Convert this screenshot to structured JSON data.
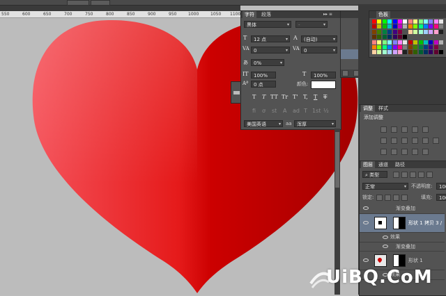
{
  "ruler": {
    "ticks": [
      "550",
      "600",
      "650",
      "700",
      "750",
      "800",
      "850",
      "900",
      "950",
      "1000",
      "1050",
      "1100"
    ]
  },
  "character_panel": {
    "tabs": [
      "字符",
      "段落"
    ],
    "font_family": "黑体",
    "font_style": "-",
    "font_size": "12 点",
    "leading": "(自动)",
    "kerning": "0",
    "tracking": "0",
    "vertical_scale_pct": "0%",
    "vertical_scale": "100%",
    "horizontal_scale": "100%",
    "baseline_shift": "0 点",
    "color_label": "颜色:",
    "color_value": "#ffffff",
    "style_glyphs": [
      "T",
      "T",
      "TT",
      "Tr",
      "T'",
      "T,",
      "T",
      "T"
    ],
    "opentype_glyphs": [
      "fi",
      "ơ",
      "st",
      "A",
      "ad",
      "T",
      "1st",
      "½"
    ],
    "language": "美国英语",
    "aa_label": "aa",
    "antialias": "浑厚"
  },
  "color_panel": {
    "tab": "色板",
    "colors": [
      "#ff0000",
      "#ffff00",
      "#00ff00",
      "#00ffff",
      "#0000ff",
      "#ff00ff",
      "#ffffff",
      "#ff8080",
      "#ffff80",
      "#80ff80",
      "#80ffff",
      "#8080ff",
      "#ff80ff",
      "#e6e6e6",
      "#c00000",
      "#c0c000",
      "#00c000",
      "#00c0c0",
      "#0000c0",
      "#c000c0",
      "#b0b0b0",
      "#ff8000",
      "#80ff00",
      "#00ff80",
      "#0080ff",
      "#8000ff",
      "#ff0080",
      "#808080",
      "#804000",
      "#408000",
      "#008040",
      "#004080",
      "#400080",
      "#800040",
      "#505050",
      "#ffd0a0",
      "#d0ffa0",
      "#a0ffd0",
      "#a0d0ff",
      "#d0a0ff",
      "#ffa0d0",
      "#202020",
      "#603000",
      "#306000",
      "#006030",
      "#003060",
      "#300060",
      "#600030",
      "#000000"
    ]
  },
  "adjust_panel": {
    "tabs": [
      "调整",
      "样式"
    ],
    "title": "添加调整"
  },
  "layers_panel": {
    "tabs": [
      "图层",
      "通道",
      "路径"
    ],
    "filter_kind": "类型",
    "blend_mode": "正常",
    "opacity_label": "不透明度:",
    "opacity_value": "100%",
    "lock_label": "锁定:",
    "fill_label": "填充:",
    "fill_value": "100%",
    "rows": [
      {
        "name": "渐变叠加",
        "type": "effect"
      },
      {
        "name": "形状 1 拷贝 3 /",
        "type": "layer"
      },
      {
        "name": "效果",
        "type": "effect"
      },
      {
        "name": "渐变叠加",
        "type": "effect"
      },
      {
        "name": "形状 1",
        "type": "layer"
      },
      {
        "name": "效果",
        "type": "effect"
      }
    ]
  },
  "watermark": {
    "text": "UiBQ.CoM"
  },
  "colors": {
    "heart_light": "#f5525a",
    "heart_dark": "#a30000",
    "panel_bg": "#535353"
  }
}
